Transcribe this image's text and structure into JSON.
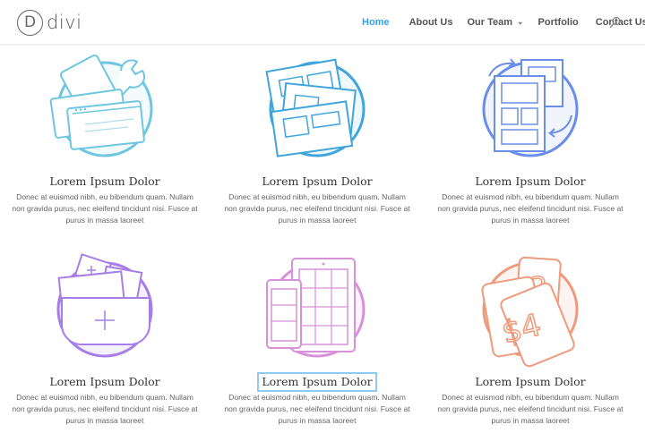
{
  "header": {
    "logo_text": "divi",
    "logo_letter": "D",
    "nav": [
      {
        "label": "Home",
        "active": true
      },
      {
        "label": "About Us"
      },
      {
        "label": "Our Team",
        "has_dropdown": true
      },
      {
        "label": "Portfolio"
      },
      {
        "label": "Contact Us"
      }
    ],
    "search_icon": "search-icon"
  },
  "colors": {
    "accent": "#2ea3f2",
    "card1": "#6ec6e0",
    "card2": "#3fa5dc",
    "card3": "#6a8ee8",
    "card4": "#a77ee8",
    "card5": "#d890d8",
    "card6": "#ee9a7c"
  },
  "cards": [
    {
      "title": "Lorem Ipsum Dolor",
      "text": "Donec at euismod nibh, eu bibendum quam. Nullam non gravida purus, nec  eleifend tincidunt nisi. Fusce at purus in massa laoreet",
      "icon": "browser-tools-icon"
    },
    {
      "title": "Lorem Ipsum Dolor",
      "text": "Donec at euismod nibh, eu bibendum quam. Nullam non gravida purus, nec  eleifend tincidunt nisi. Fusce at purus in massa laoreet",
      "icon": "layout-stack-icon"
    },
    {
      "title": "Lorem Ipsum Dolor",
      "text": "Donec at euismod nibh, eu bibendum quam. Nullam non gravida purus, nec  eleifend tincidunt nisi. Fusce at purus in massa laoreet",
      "icon": "sync-pages-icon"
    },
    {
      "title": "Lorem Ipsum Dolor",
      "text": "Donec at euismod nibh, eu bibendum quam. Nullam non gravida purus, nec  eleifend tincidunt nisi. Fusce at purus in massa laoreet",
      "icon": "folder-icon"
    },
    {
      "title": "Lorem Ipsum Dolor",
      "text": "Donec at euismod nibh, eu bibendum quam. Nullam non gravida purus, nec  eleifend tincidunt nisi. Fusce at purus in massa laoreet",
      "icon": "tablet-phone-icon"
    },
    {
      "title": "Lorem Ipsum Dolor",
      "text": "Donec at euismod nibh, eu bibendum quam. Nullam non gravida purus, nec  eleifend tincidunt nisi. Fusce at purus in massa laoreet",
      "icon": "pricing-cards-icon"
    }
  ]
}
